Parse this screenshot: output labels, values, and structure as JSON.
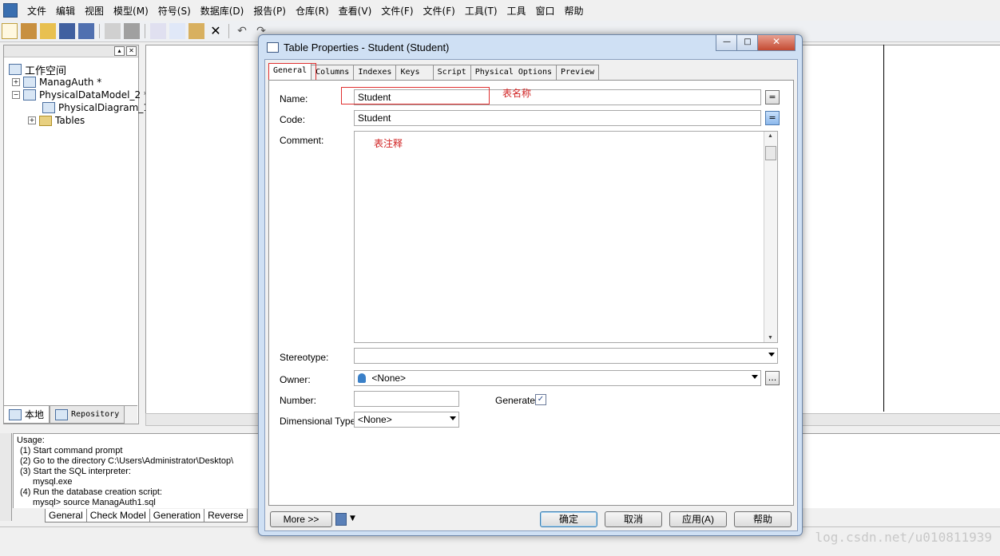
{
  "menu": [
    "文件",
    "编辑",
    "视图",
    "模型(M)",
    "符号(S)",
    "数据库(D)",
    "报告(P)",
    "仓库(R)",
    "查看(V)",
    "文件(F)",
    "文件(F)",
    "工具(T)",
    "工具",
    "窗口",
    "帮助"
  ],
  "workspace": {
    "root": "工作空间",
    "items": [
      {
        "label": "ManagAuth *"
      },
      {
        "label": "PhysicalDataModel_2 *"
      },
      {
        "label": "PhysicalDiagram_1"
      },
      {
        "label": "Tables"
      }
    ],
    "tabs": [
      "本地",
      "Repository"
    ]
  },
  "output": {
    "lines": [
      "Usage:",
      "(1) Start command prompt",
      "(2) Go to the directory C:\\Users\\Administrator\\Desktop\\",
      "(3) Start the SQL interpreter:",
      "mysql.exe",
      "(4) Run the database creation script:",
      "mysql> source ManagAuth1.sql"
    ],
    "tabs": [
      "General",
      "Check Model",
      "Generation",
      "Reverse"
    ]
  },
  "watermark": "log.csdn.net/u010811939",
  "dialog": {
    "title": "Table Properties - Student (Student)",
    "tabs": [
      "General",
      "Columns",
      "Indexes",
      "Keys",
      "Script",
      "Physical Options",
      "Preview"
    ],
    "fields": {
      "name_label": "Name:",
      "name_value": "Student",
      "name_annotation": "表名称",
      "code_label": "Code:",
      "code_value": "Student",
      "comment_label": "Comment:",
      "comment_annotation": "表注释",
      "stereotype_label": "Stereotype:",
      "stereotype_value": "",
      "owner_label": "Owner:",
      "owner_value": "<None>",
      "number_label": "Number:",
      "number_value": "",
      "generate_label": "Generate:",
      "generate_checked": true,
      "dimensional_label": "Dimensional Type:",
      "dimensional_value": "<None>",
      "ellipsis": "...",
      "equals": "="
    },
    "buttons": {
      "more": "More >>",
      "ok": "确定",
      "cancel": "取消",
      "apply": "应用(A)",
      "help": "帮助"
    }
  }
}
